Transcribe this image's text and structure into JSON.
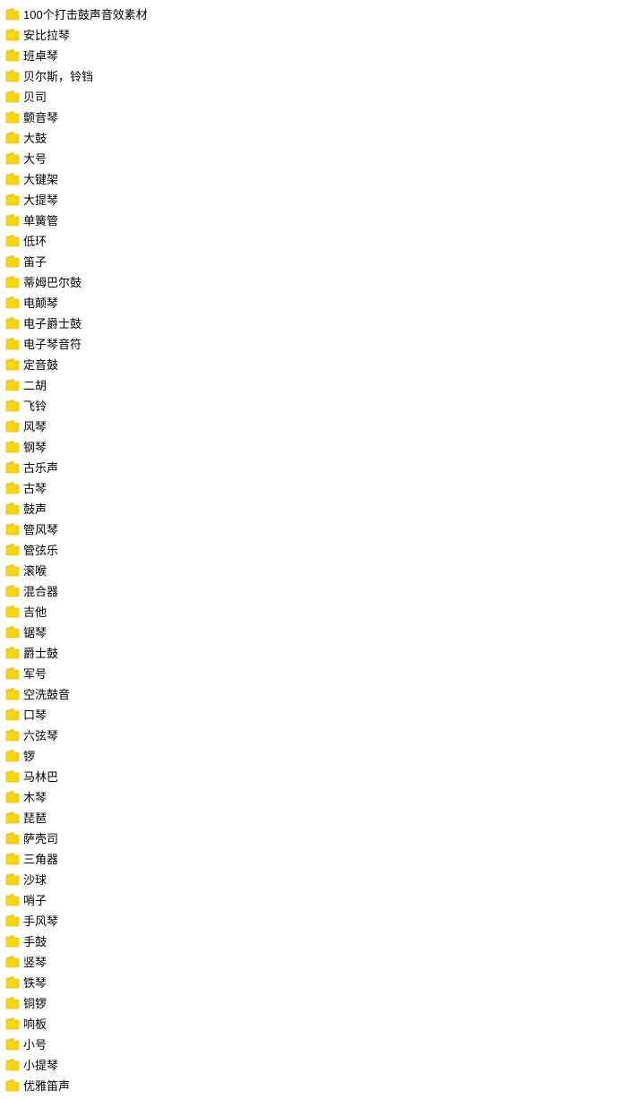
{
  "tree": {
    "items": [
      {
        "id": "root",
        "label": "100个打击鼓声音效素材",
        "level": 0,
        "isRoot": true
      },
      {
        "id": "1",
        "label": "安比拉琴",
        "level": 1
      },
      {
        "id": "2",
        "label": "班卓琴",
        "level": 1
      },
      {
        "id": "3",
        "label": "贝尔斯，铃铛",
        "level": 1
      },
      {
        "id": "4",
        "label": "贝司",
        "level": 1
      },
      {
        "id": "5",
        "label": "颤音琴",
        "level": 1
      },
      {
        "id": "6",
        "label": "大鼓",
        "level": 1
      },
      {
        "id": "7",
        "label": "大号",
        "level": 1
      },
      {
        "id": "8",
        "label": "大键架",
        "level": 1
      },
      {
        "id": "9",
        "label": "大提琴",
        "level": 1
      },
      {
        "id": "10",
        "label": "单簧管",
        "level": 1
      },
      {
        "id": "11",
        "label": "低环",
        "level": 1
      },
      {
        "id": "12",
        "label": "笛子",
        "level": 1
      },
      {
        "id": "13",
        "label": "蒂姆巴尔鼓",
        "level": 1
      },
      {
        "id": "14",
        "label": "电颠琴",
        "level": 1
      },
      {
        "id": "15",
        "label": "电子爵士鼓",
        "level": 1
      },
      {
        "id": "16",
        "label": "电子琴音符",
        "level": 1
      },
      {
        "id": "17",
        "label": "定音鼓",
        "level": 1
      },
      {
        "id": "18",
        "label": "二胡",
        "level": 1
      },
      {
        "id": "19",
        "label": "飞铃",
        "level": 1
      },
      {
        "id": "20",
        "label": "风琴",
        "level": 1
      },
      {
        "id": "21",
        "label": "钢琴",
        "level": 1
      },
      {
        "id": "22",
        "label": "古乐声",
        "level": 1
      },
      {
        "id": "23",
        "label": "古琴",
        "level": 1
      },
      {
        "id": "24",
        "label": "鼓声",
        "level": 1
      },
      {
        "id": "25",
        "label": "管风琴",
        "level": 1
      },
      {
        "id": "26",
        "label": "管弦乐",
        "level": 1
      },
      {
        "id": "27",
        "label": "滚喉",
        "level": 1
      },
      {
        "id": "28",
        "label": "混合器",
        "level": 1
      },
      {
        "id": "29",
        "label": "吉他",
        "level": 1
      },
      {
        "id": "30",
        "label": "锯琴",
        "level": 1
      },
      {
        "id": "31",
        "label": "爵士鼓",
        "level": 1
      },
      {
        "id": "32",
        "label": "军号",
        "level": 1
      },
      {
        "id": "33",
        "label": "空洗鼓音",
        "level": 1
      },
      {
        "id": "34",
        "label": "口琴",
        "level": 1
      },
      {
        "id": "35",
        "label": "六弦琴",
        "level": 1
      },
      {
        "id": "36",
        "label": "锣",
        "level": 1
      },
      {
        "id": "37",
        "label": "马林巴",
        "level": 1
      },
      {
        "id": "38",
        "label": "木琴",
        "level": 1
      },
      {
        "id": "39",
        "label": "琵琶",
        "level": 1
      },
      {
        "id": "40",
        "label": "萨壳司",
        "level": 1
      },
      {
        "id": "41",
        "label": "三角器",
        "level": 1
      },
      {
        "id": "42",
        "label": "沙球",
        "level": 1
      },
      {
        "id": "43",
        "label": "哨子",
        "level": 1
      },
      {
        "id": "44",
        "label": "手风琴",
        "level": 1
      },
      {
        "id": "45",
        "label": "手鼓",
        "level": 1
      },
      {
        "id": "46",
        "label": "竖琴",
        "level": 1
      },
      {
        "id": "47",
        "label": "铁琴",
        "level": 1
      },
      {
        "id": "48",
        "label": "铜锣",
        "level": 1
      },
      {
        "id": "49",
        "label": "响板",
        "level": 1
      },
      {
        "id": "50",
        "label": "小号",
        "level": 1
      },
      {
        "id": "51",
        "label": "小提琴",
        "level": 1
      },
      {
        "id": "52",
        "label": "优雅笛声",
        "level": 1
      }
    ]
  },
  "colors": {
    "folder_body": "#FFD700",
    "folder_tab": "#FFB800",
    "folder_border": "#E8A800"
  }
}
